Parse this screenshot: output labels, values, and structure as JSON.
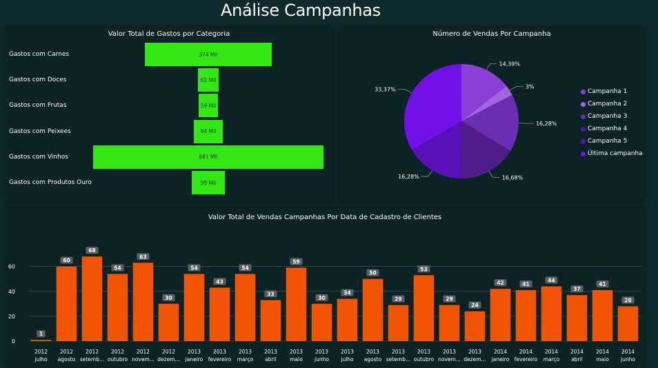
{
  "page": {
    "title": "Análise Campanhas"
  },
  "funnel": {
    "title": "Valor Total de Gastos por Categoria",
    "max": 681,
    "items": [
      {
        "label": "Gastos com Carnes",
        "value": 374,
        "display": "374 Mil"
      },
      {
        "label": "Gastos com Doces",
        "value": 61,
        "display": "61 Mil"
      },
      {
        "label": "Gastos com Frutas",
        "value": 59,
        "display": "59 Mil"
      },
      {
        "label": "Gastos com Peixees",
        "value": 84,
        "display": "84 Mil"
      },
      {
        "label": "Gastos com Vinhos",
        "value": 681,
        "display": "681 Mil"
      },
      {
        "label": "Gastos com Produtos Ouro",
        "value": 99,
        "display": "99 Mil"
      }
    ],
    "color": "#33e812"
  },
  "pie": {
    "title": "Número de Vendas Por Campanha",
    "slices": [
      {
        "name": "Campanha 1",
        "value": 14.39,
        "label": "14,39%",
        "color": "#8b3fd6"
      },
      {
        "name": "Campanha 2",
        "value": 3.0,
        "label": "3%",
        "color": "#a463e2"
      },
      {
        "name": "Campanha 3",
        "value": 16.28,
        "label": "16,28%",
        "color": "#6a2eb0"
      },
      {
        "name": "Campanha 4",
        "value": 16.68,
        "label": "16,68%",
        "color": "#4e1d8a"
      },
      {
        "name": "Campanha 5",
        "value": 16.28,
        "label": "16,28%",
        "color": "#5a0fb8"
      },
      {
        "name": "Última campanha",
        "value": 33.37,
        "label": "33,37%",
        "color": "#7111e8"
      }
    ]
  },
  "chart_data": [
    {
      "type": "bar",
      "title": "Valor Total de Gastos por Categoria",
      "categories": [
        "Gastos com Carnes",
        "Gastos com Doces",
        "Gastos com Frutas",
        "Gastos com Peixees",
        "Gastos com Vinhos",
        "Gastos com Produtos Ouro"
      ],
      "values": [
        374,
        61,
        59,
        84,
        681,
        99
      ],
      "unit": "Mil"
    },
    {
      "type": "pie",
      "title": "Número de Vendas Por Campanha",
      "categories": [
        "Campanha 1",
        "Campanha 2",
        "Campanha 3",
        "Campanha 4",
        "Campanha 5",
        "Última campanha"
      ],
      "values": [
        14.39,
        3.0,
        16.28,
        16.68,
        16.28,
        33.37
      ],
      "legend": "right"
    },
    {
      "type": "bar",
      "title": "Valor Total de Vendas Campanhas Por Data de Cadastro de Clientes",
      "years": [
        "2012",
        "2012",
        "2012",
        "2012",
        "2012",
        "2012",
        "2013",
        "2013",
        "2013",
        "2013",
        "2013",
        "2013",
        "2013",
        "2013",
        "2013",
        "2013",
        "2013",
        "2013",
        "2014",
        "2014",
        "2014",
        "2014",
        "2014",
        "2014"
      ],
      "months": [
        "julho",
        "agosto",
        "setemb...",
        "outubro",
        "novem...",
        "dezem...",
        "janeiro",
        "fevereiro",
        "março",
        "abril",
        "maio",
        "junho",
        "julho",
        "agosto",
        "setemb...",
        "outubro",
        "novem...",
        "dezem...",
        "janeiro",
        "fevereiro",
        "março",
        "abril",
        "maio",
        "junho"
      ],
      "values": [
        1,
        60,
        68,
        54,
        63,
        30,
        54,
        43,
        54,
        33,
        59,
        30,
        34,
        50,
        29,
        53,
        29,
        24,
        42,
        41,
        44,
        37,
        41,
        28
      ],
      "yticks": [
        0,
        20,
        40,
        60
      ],
      "ylim": [
        0,
        72
      ],
      "color": "#f25405",
      "grid": true
    }
  ]
}
